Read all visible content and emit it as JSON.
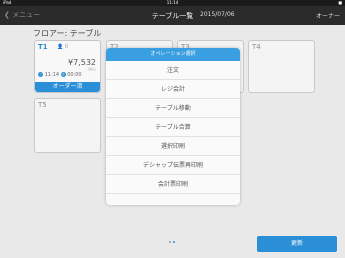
{
  "status_bar": {
    "carrier": "iPad",
    "time": "11:14",
    "battery": "■"
  },
  "nav": {
    "back_label": "メニュー",
    "title": "テーブル一覧",
    "date": "2015/07/06",
    "user": "オーナー"
  },
  "floor_label": "フロアー: テーブル",
  "tables": [
    {
      "name": "T1",
      "guests": "0",
      "amount": "¥7,532",
      "sub": "(税込)",
      "time_start": "11:14",
      "time_elapsed": "00:00",
      "status": "オーダー済"
    },
    {
      "name": "T2"
    },
    {
      "name": "T3"
    },
    {
      "name": "T4"
    },
    {
      "name": "T5"
    }
  ],
  "modal": {
    "title": "オペレーション選択",
    "items": [
      "注文",
      "レジ会計",
      "テーブル移動",
      "テーブル合算",
      "選択印刷",
      "デシャップ伝票再印刷",
      "会計票印刷"
    ]
  },
  "pager": {
    "pages": 2,
    "current": 1
  },
  "update_button": "更新",
  "colors": {
    "accent": "#2a8fd6",
    "navbar": "#2b2b2b",
    "background": "#e9e9ea"
  }
}
